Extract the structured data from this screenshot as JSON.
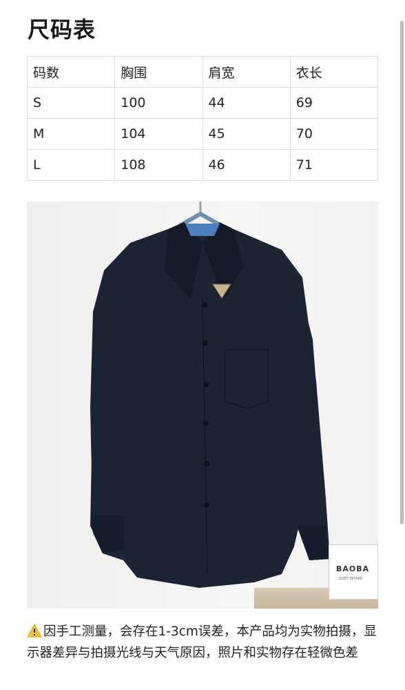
{
  "title": "尺码表",
  "size_table": {
    "headers": [
      "码数",
      "胸围",
      "肩宽",
      "衣长"
    ],
    "rows": [
      [
        "S",
        "100",
        "44",
        "69"
      ],
      [
        "M",
        "104",
        "45",
        "70"
      ],
      [
        "L",
        "108",
        "46",
        "71"
      ]
    ]
  },
  "photo": {
    "bag_brand": "BAOBA",
    "bag_sub": "ISSEY MIYAKE",
    "shirt_color": "#1c2434"
  },
  "note": {
    "icon": "warning-icon",
    "text": "因手工测量，会存在1-3cm误差，本产品均为实物拍摄，显示器差异与拍摄光线与天气原因，照片和实物存在轻微色差"
  }
}
